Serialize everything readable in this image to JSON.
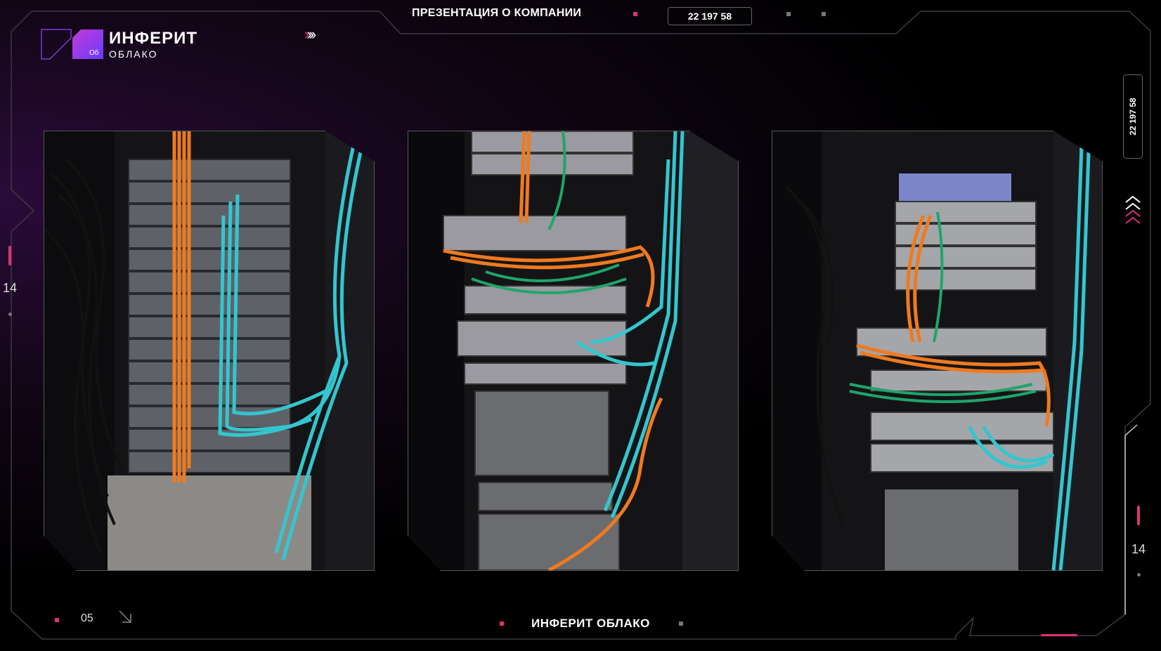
{
  "header": {
    "title": "ПРЕЗЕНТАЦИЯ О КОМПАНИИ",
    "counter": "22  197  58"
  },
  "brand": {
    "title": "ИНФЕРИТ",
    "subtitle": "ОБЛАКО",
    "mark_label": "Об"
  },
  "side": {
    "counter": "22  197  58",
    "left_number": "14",
    "right_number": "14"
  },
  "footer": {
    "page_number": "05",
    "title": "ИНФЕРИТ ОБЛАКО"
  },
  "photos": [
    {
      "name": "server-rack-photo-1"
    },
    {
      "name": "server-rack-photo-2"
    },
    {
      "name": "server-rack-photo-3"
    }
  ],
  "colors": {
    "accent": "#e0307a",
    "orange_cable": "#f07a1e",
    "cyan_cable": "#34c6cf",
    "green_cable": "#1fa56a"
  }
}
